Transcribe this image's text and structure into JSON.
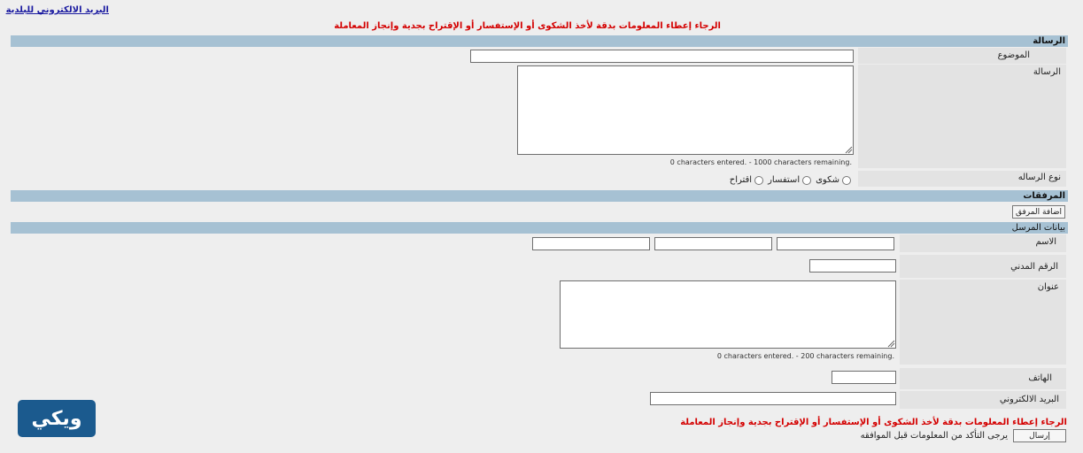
{
  "header": {
    "email_link": "البريد الالكتروني للبلدية",
    "notice_text": "الرجاء إعطاء المعلومات بدقة لأخذ الشكوى أو الإستفسار أو الإقتراح بجدية وإنجاز المعاملة"
  },
  "message_section": {
    "title": "الرسالة",
    "subject_label": "الموضوع",
    "subject_value": "",
    "message_label": "الرسالة",
    "message_value": "",
    "message_counter": "0 characters entered.   -   1000 characters remaining.",
    "type_label": "نوع الرساله",
    "type_options": [
      "شكوى",
      "استفسار",
      "اقتراح"
    ]
  },
  "attachments_section": {
    "title": "المرفقات",
    "add_attachment_button": "اضافة المرفق"
  },
  "sender_section": {
    "title": "بيانات المرسل",
    "name_label": "الاسم",
    "civil_id_label": "الرقم المدني",
    "address_label": "عنوان",
    "address_counter": "0 characters entered.   -   200 characters remaining.",
    "phone_label": "الهاتف",
    "email_label": "البريد الالكتروني"
  },
  "footer": {
    "notice_text": "الرجاء إعطاء المعلومات بدقة لأخذ الشكوى أو الإستفسار أو الإقتراح بجدية وإنجاز المعاملة",
    "confirm_text": "يرجى التأكد من المعلومات قبل الموافقه",
    "send_button": "إرسال"
  },
  "logo": {
    "text": "ويكي"
  },
  "colors": {
    "page_background": "#eeeeee",
    "section_bar": "#a6c1d3",
    "label_cell": "#e3e3e3",
    "notice_red": "#d40000",
    "link_blue": "#1a1aa0",
    "logo_blue": "#1b5a8e"
  }
}
